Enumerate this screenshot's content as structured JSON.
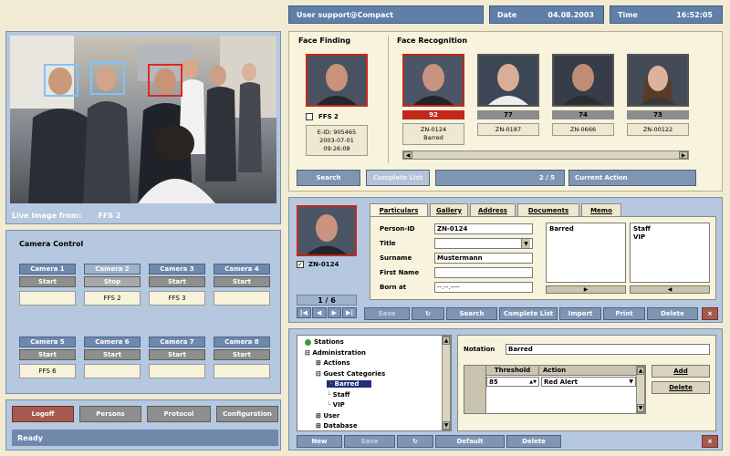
{
  "header": {
    "user_label": "User support@Compact",
    "date_label": "Date",
    "date_value": "04.08.2003",
    "time_label": "Time",
    "time_value": "16:52:05"
  },
  "live": {
    "label": "Live Image from:",
    "source": "FFS 2"
  },
  "face_finding": {
    "title": "Face Finding",
    "checkbox_label": "FFS 2",
    "info_line1": "E-ID: 905465",
    "info_line2": "2003-07-01",
    "info_line3": "09:26:08"
  },
  "face_recognition": {
    "title": "Face Recognition",
    "candidates": [
      {
        "score": "92",
        "id": "ZN-0124",
        "note": "Barred"
      },
      {
        "score": "77",
        "id": "ZN-0187",
        "note": ""
      },
      {
        "score": "74",
        "id": "ZN-0666",
        "note": ""
      },
      {
        "score": "73",
        "id": "ZN-00122",
        "note": ""
      }
    ]
  },
  "action_bar": {
    "search": "Search",
    "complete_list": "Complete List",
    "pager": "2 / 5",
    "current_action": "Current Action"
  },
  "camera_control": {
    "title": "Camera Control",
    "cameras": [
      {
        "name": "Camera 1",
        "action": "Start",
        "status": ""
      },
      {
        "name": "Camera 2",
        "action": "Stop",
        "status": "FFS 2"
      },
      {
        "name": "Camera 3",
        "action": "Start",
        "status": "FFS 3"
      },
      {
        "name": "Camera 4",
        "action": "Start",
        "status": ""
      },
      {
        "name": "Camera 5",
        "action": "Start",
        "status": "FFS 6"
      },
      {
        "name": "Camera 6",
        "action": "Start",
        "status": ""
      },
      {
        "name": "Camera 7",
        "action": "Start",
        "status": ""
      },
      {
        "name": "Camera 8",
        "action": "Start",
        "status": ""
      }
    ]
  },
  "bottom_nav": {
    "logoff": "Logoff",
    "persons": "Persons",
    "protocol": "Protocol",
    "configuration": "Configuration",
    "status": "Ready"
  },
  "person": {
    "checkbox_label": "ZN-0124",
    "pager": "1 / 6",
    "tabs": [
      "Particulars",
      "Gallery",
      "Address",
      "Documents",
      "Memo"
    ],
    "fields": {
      "person_id_label": "Person-ID",
      "person_id_value": "ZN-0124",
      "title_label": "Title",
      "title_value": "",
      "surname_label": "Surname",
      "surname_value": "Mustermann",
      "first_name_label": "First Name",
      "first_name_value": "",
      "born_label": "Born at",
      "born_value": "--.--.----"
    },
    "list_left": [
      "Barred"
    ],
    "list_right": [
      "Staff",
      "VIP"
    ],
    "buttons": {
      "save": "Save",
      "search": "Search",
      "complete_list": "Complete List",
      "import": "Import",
      "print": "Print",
      "delete": "Delete",
      "close": "×"
    }
  },
  "admin": {
    "tree": [
      {
        "label": "Stations",
        "level": 0
      },
      {
        "label": "Administration",
        "level": 0
      },
      {
        "label": "Actions",
        "level": 1
      },
      {
        "label": "Guest Categories",
        "level": 1
      },
      {
        "label": "Barred",
        "level": 2
      },
      {
        "label": "Staff",
        "level": 2
      },
      {
        "label": "VIP",
        "level": 2
      },
      {
        "label": "User",
        "level": 1
      },
      {
        "label": "Database",
        "level": 1
      }
    ],
    "notation_label": "Notation",
    "notation_value": "Barred",
    "table_headers": [
      "Threshold",
      "Action"
    ],
    "rows": [
      {
        "threshold": "85",
        "action": "Red Alert"
      }
    ],
    "add": "Add",
    "delete_row": "Delete",
    "buttons": {
      "new": "New",
      "save": "Save",
      "default": "Default",
      "delete": "Delete",
      "close": "×"
    }
  },
  "colors": {
    "panel_blue": "#b5c8df",
    "header_blue": "#5f7fa8",
    "cream": "#f8f3dc",
    "alert_red": "#c2281c"
  },
  "icons": {
    "first": "first-page-icon",
    "prev": "prev-page-icon",
    "next": "next-page-icon",
    "last": "last-page-icon",
    "refresh": "refresh-icon",
    "station": "station-icon"
  }
}
